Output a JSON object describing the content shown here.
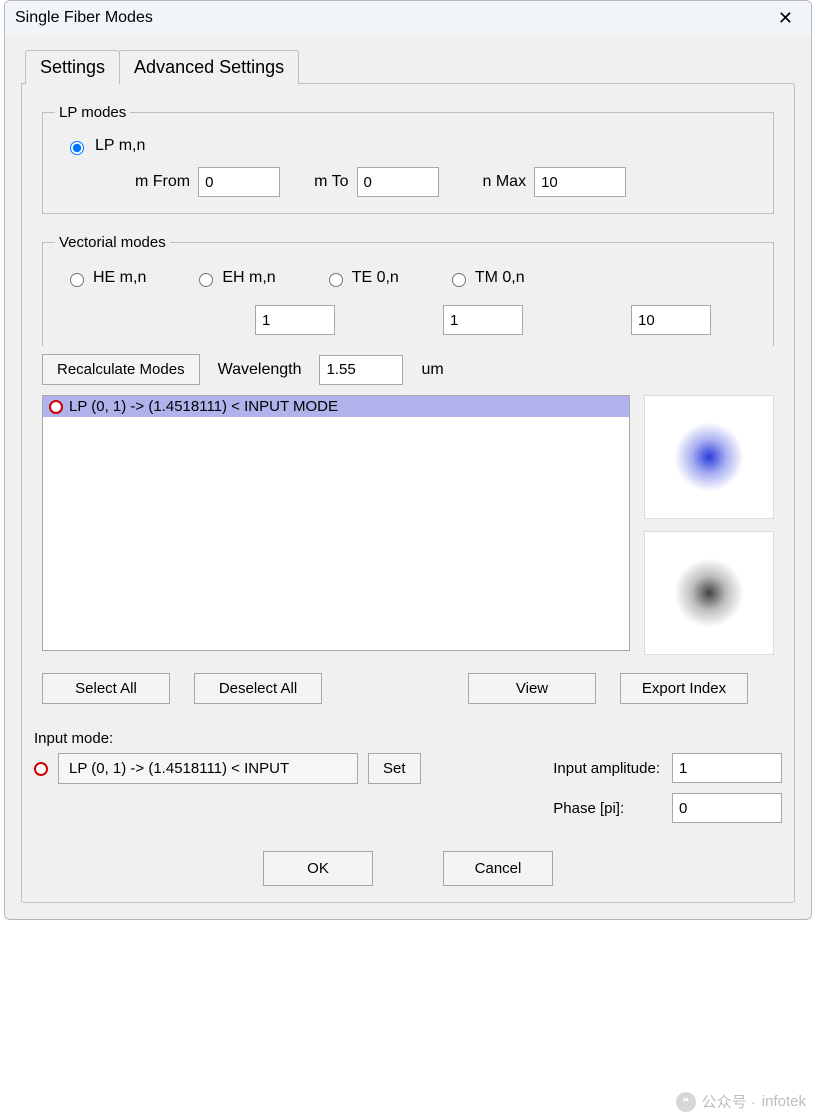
{
  "window": {
    "title": "Single Fiber Modes"
  },
  "tabs": {
    "settings": "Settings",
    "advanced": "Advanced Settings"
  },
  "lp": {
    "legend": "LP modes",
    "radio_label": "LP m,n",
    "m_from_label": "m   From",
    "m_from_value": "0",
    "m_to_label": "m   To",
    "m_to_value": "0",
    "n_max_label": "n   Max",
    "n_max_value": "10"
  },
  "vect": {
    "legend": "Vectorial modes",
    "he": "HE m,n",
    "eh": "EH m,n",
    "te": "TE 0,n",
    "tm": "TM 0,n",
    "v1": "1",
    "v2": "1",
    "v3": "10"
  },
  "recalc": {
    "button": "Recalculate Modes",
    "wl_label": "Wavelength",
    "wl_value": "1.55",
    "wl_unit": "um"
  },
  "list": {
    "items": [
      "LP (0, 1) -> (1.4518111) < INPUT MODE"
    ]
  },
  "sel": {
    "select_all": "Select All",
    "deselect_all": "Deselect All",
    "view": "View",
    "export": "Export Index"
  },
  "inputmode": {
    "label": "Input mode:",
    "value": "LP (0, 1) -> (1.4518111) < INPUT",
    "set": "Set",
    "amp_label": "Input amplitude:",
    "amp_value": "1",
    "phase_label": "Phase [pi]:",
    "phase_value": "0"
  },
  "dlg": {
    "ok": "OK",
    "cancel": "Cancel"
  },
  "watermark": {
    "prefix": "公众号 · ",
    "name": "infotek"
  }
}
